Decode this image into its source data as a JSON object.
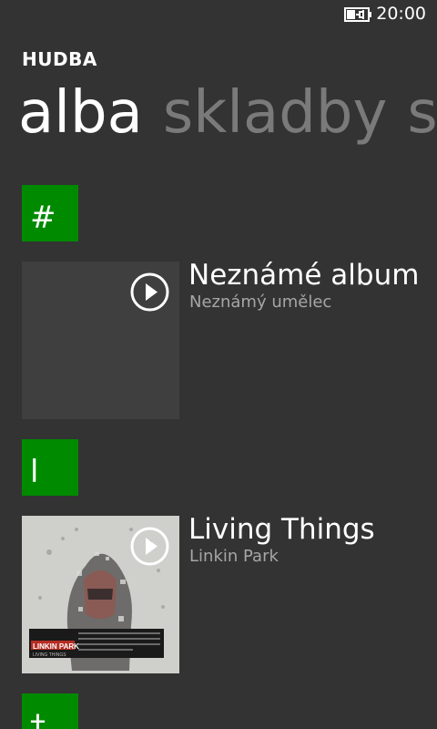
{
  "status": {
    "time": "20:00",
    "battery_icon": "battery-charging-icon"
  },
  "app": {
    "title": "HUDBA"
  },
  "pivot": {
    "items": [
      "alba",
      "skladby",
      "se"
    ],
    "active_index": 0
  },
  "groups": [
    {
      "letter": "#",
      "albums": [
        {
          "title": "Neznámé album",
          "artist": "Neznámý umělec",
          "art": "blank"
        }
      ]
    },
    {
      "letter": "l",
      "albums": [
        {
          "title": "Living Things",
          "artist": "Linkin Park",
          "art": "cover",
          "art_text": "LINKIN PARK",
          "art_subtext": "LIVING THINGS"
        }
      ]
    },
    {
      "letter": "†",
      "albums": []
    }
  ],
  "colors": {
    "background": "#333333",
    "accent": "#008a00",
    "inactive_text": "#7a7a7a",
    "secondary_text": "#a6a6a6"
  }
}
